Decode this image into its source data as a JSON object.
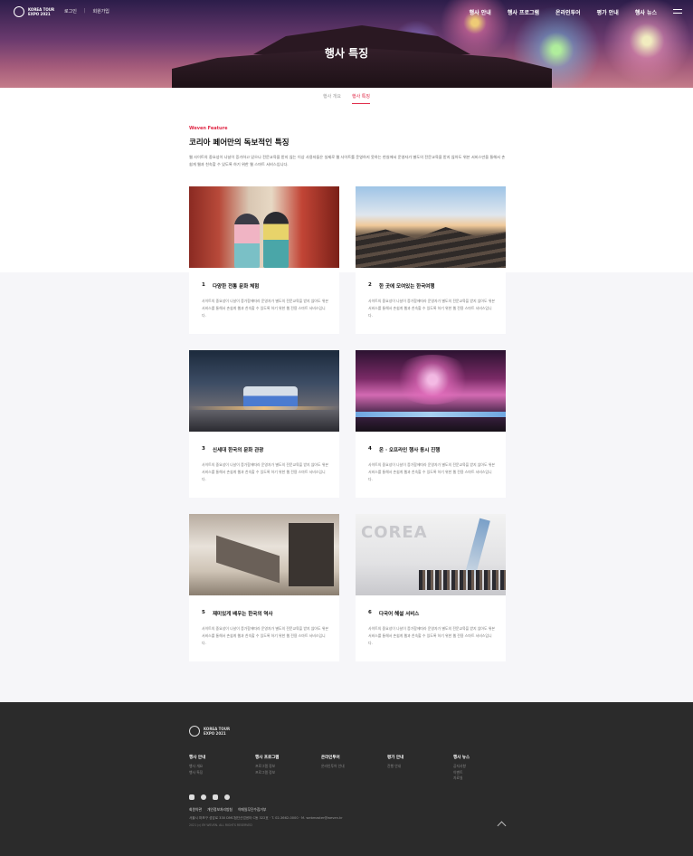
{
  "brand": {
    "logo_text": "KOREA TOUR EXPO 2021"
  },
  "header": {
    "top_links": [
      "로그인",
      "회원가입"
    ],
    "nav": [
      "행사 안내",
      "행사 프로그램",
      "온라인투어",
      "평가 안내",
      "행사 뉴스"
    ],
    "page_title": "행사 특징"
  },
  "tabs": [
    {
      "label": "행사 개요",
      "active": false
    },
    {
      "label": "행사 특징",
      "active": true
    }
  ],
  "section": {
    "eyebrow": "Weven Feature",
    "title": "코리아 페어만의 독보적인 특징",
    "description": "웹 사이트의 중요성이 나날이 증가하고 있으나 전문교육을 받지 않는 이상 사용자들은 실제로 웹 사이트를 운영하지 못하는 현실에서 운영자가 별도의 전문교육을 받지 않아도 위븐 서비스만을 통해서 손쉽게 웹과 친숙할 수 있도록 하기 위한 웹 스마트 서비스입니다."
  },
  "cards": [
    {
      "num": "1",
      "title": "다양한 전통 문화 체험",
      "desc": "사이트의 중요성이 나날이 증가함에따라 운영자가 별도의 전문교육을 받지 않아도 위븐 서비스를 통해서 손쉽게 웹과 친숙할 수 있도록 하기 위한 웹 전용 스마트 서비스입니다."
    },
    {
      "num": "2",
      "title": "한 곳에 모여있는 한국여행",
      "desc": "사이트의 중요성이 나날이 증가함에따라 운영자가 별도의 전문교육을 받지 않아도 위븐 서비스를 통해서 손쉽게 웹과 친숙할 수 있도록 하기 위한 웹 전용 스마트 서비스입니다."
    },
    {
      "num": "3",
      "title": "신세대 한국의 문화 관광",
      "desc": "사이트의 중요성이 나날이 증가함에따라 운영자가 별도의 전문교육을 받지 않아도 위븐 서비스를 통해서 손쉽게 웹과 친숙할 수 있도록 하기 위한 웹 전용 스마트 서비스입니다."
    },
    {
      "num": "4",
      "title": "온 · 오프라인 행사 동시 진행",
      "desc": "사이트의 중요성이 나날이 증가함에따라 운영자가 별도의 전문교육을 받지 않아도 위븐 서비스를 통해서 손쉽게 웹과 친숙할 수 있도록 하기 위한 웹 전용 스마트 서비스입니다."
    },
    {
      "num": "5",
      "title": "재미있게 배우는 한국의 역사",
      "desc": "사이트의 중요성이 나날이 증가함에따라 운영자가 별도의 전문교육을 받지 않아도 위븐 서비스를 통해서 손쉽게 웹과 친숙할 수 있도록 하기 위한 웹 전용 스마트 서비스입니다."
    },
    {
      "num": "6",
      "title": "다국어 해설 서비스",
      "desc": "사이트의 중요성이 나날이 증가함에따라 운영자가 별도의 전문교육을 받지 않아도 위븐 서비스를 통해서 손쉽게 웹과 친숙할 수 있도록 하기 위한 웹 전용 스마트 서비스입니다."
    }
  ],
  "footer": {
    "columns": [
      {
        "heading": "행사 안내",
        "items": [
          "행사 개요",
          "행사 특징"
        ]
      },
      {
        "heading": "행사 프로그램",
        "items": [
          "프로그램 정보",
          "프로그램 정보"
        ]
      },
      {
        "heading": "온라인투어",
        "items": [
          "온라인투어 안내"
        ]
      },
      {
        "heading": "평가 안내",
        "items": [
          "진행 안내"
        ]
      },
      {
        "heading": "행사 뉴스",
        "items": [
          "공지사항",
          "이벤트",
          "자료실"
        ]
      }
    ],
    "social": [
      "facebook-icon",
      "instagram-circle-icon",
      "blog-icon",
      "instagram-icon"
    ],
    "links": [
      "회원약관",
      "개인정보처리방침",
      "이메일무단수집거부"
    ],
    "address": "서울시 마포구 성암로 330 DMC첨단산업센터 C동 322호 · T. 02-3662-0000 · M. webmaster@weven.kr",
    "copyright": "2021 (c) BY WEVEN. ALL RIGHTS RESERVED"
  },
  "colors": {
    "accent": "#e02a48",
    "footer_bg": "#2b2b2b"
  }
}
